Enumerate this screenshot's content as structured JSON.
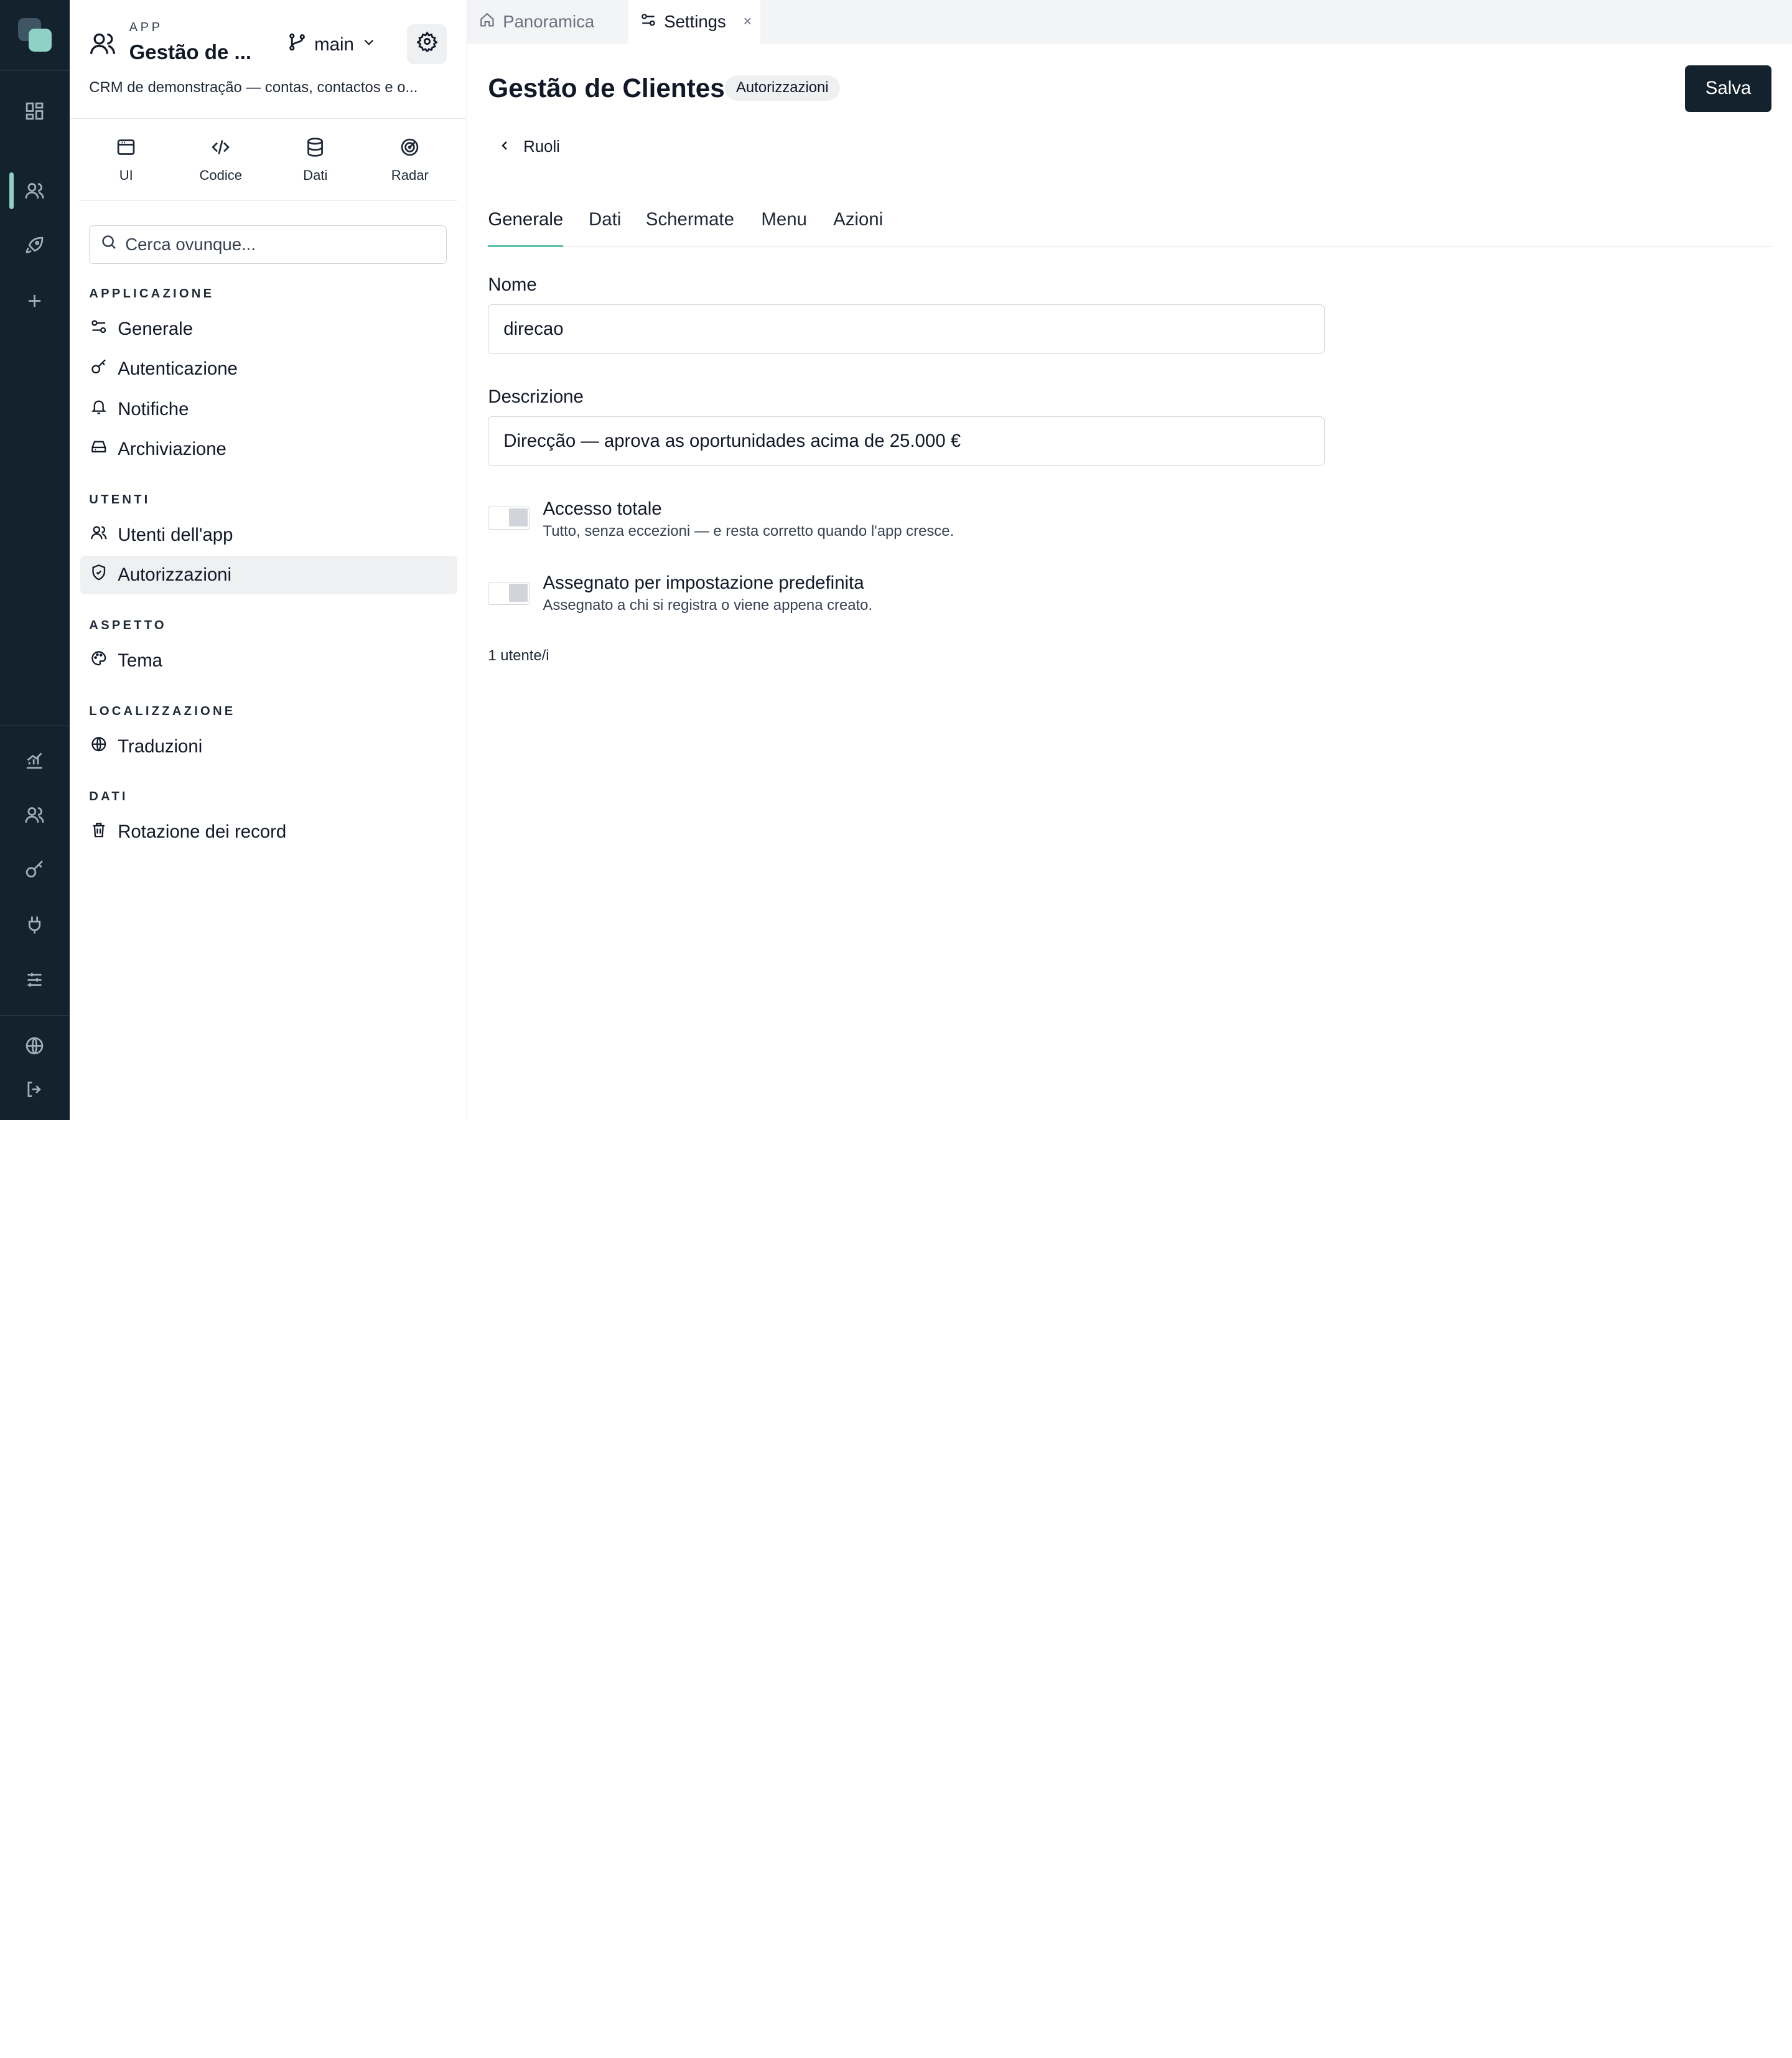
{
  "app": {
    "kicker": "APP",
    "name": "Gestão de ...",
    "description": "CRM de demonstração — contas, contactos e o...",
    "branch": "main"
  },
  "rail": {
    "icons": [
      "dashboard-icon",
      "users-icon",
      "rocket-icon",
      "plus-icon",
      "analytics-icon",
      "team-icon",
      "key-icon",
      "plug-icon",
      "sliders-icon",
      "globe-icon",
      "logout-icon"
    ]
  },
  "modes": [
    {
      "label": "UI",
      "icon": "window-icon"
    },
    {
      "label": "Codice",
      "icon": "code-icon"
    },
    {
      "label": "Dati",
      "icon": "database-icon"
    },
    {
      "label": "Radar",
      "icon": "radar-icon"
    }
  ],
  "search": {
    "placeholder": "Cerca ovunque..."
  },
  "sidebar": {
    "sections": [
      {
        "label": "APPLICAZIONE",
        "items": [
          "Generale",
          "Autenticazione",
          "Notifiche",
          "Archiviazione"
        ]
      },
      {
        "label": "UTENTI",
        "items": [
          "Utenti dell'app",
          "Autorizzazioni"
        ]
      },
      {
        "label": "ASPETTO",
        "items": [
          "Tema"
        ]
      },
      {
        "label": "LOCALIZZAZIONE",
        "items": [
          "Traduzioni"
        ]
      },
      {
        "label": "DATI",
        "items": [
          "Rotazione dei record"
        ]
      }
    ],
    "active_item": "Autorizzazioni"
  },
  "window_tabs": [
    {
      "label": "Panoramica",
      "active": false
    },
    {
      "label": "Settings",
      "active": true,
      "close": "×"
    }
  ],
  "page": {
    "title": "Gestão de Clientes",
    "badge": "Autorizzazioni",
    "save_label": "Salva",
    "back_label": "Ruoli"
  },
  "subtabs": [
    "Generale",
    "Dati",
    "Schermate",
    "Menu",
    "Azioni"
  ],
  "active_subtab": "Generale",
  "form": {
    "name_label": "Nome",
    "name_value": "direcao",
    "description_label": "Descrizione",
    "description_value": "Direcção — aprova as oportunidades acima de 25.000 €",
    "full_access": {
      "title": "Accesso totale",
      "subtitle": "Tutto, senza eccezioni — e resta corretto quando l'app cresce.",
      "enabled": false
    },
    "default_assigned": {
      "title": "Assegnato per impostazione predefinita",
      "subtitle": "Assegnato a chi si registra o viene appena creato.",
      "enabled": false
    },
    "users_count": "1 utente/i"
  },
  "colors": {
    "rail_bg": "#13222d",
    "accent": "#5ec0ae",
    "primary_button": "#13222d"
  }
}
